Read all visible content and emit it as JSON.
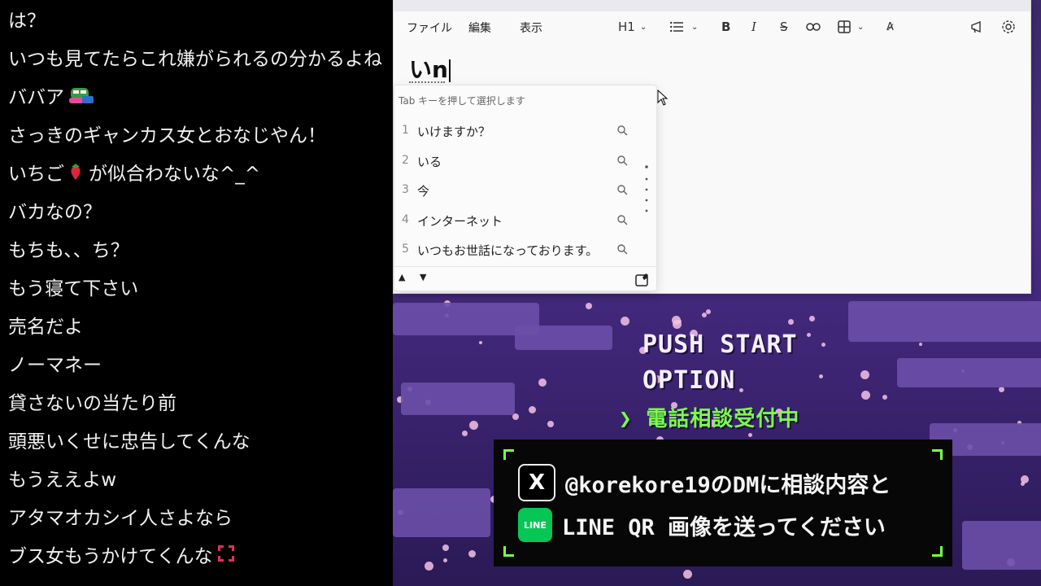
{
  "chat": {
    "messages": [
      {
        "text": "は？"
      },
      {
        "text": "いつも見てたらこれ嫌がられるの分かるよね"
      },
      {
        "text": "ババア",
        "emoji": "pixel-frog-emote"
      },
      {
        "text": "さっきのギャンカス女とおなじやん！"
      },
      {
        "text": "いちご",
        "emoji": "strawberry",
        "suffix": "が似合わないな^_^"
      },
      {
        "text": "バカなの？"
      },
      {
        "text": "もちも、、ち？"
      },
      {
        "text": "もう寝て下さい"
      },
      {
        "text": "売名だよ"
      },
      {
        "text": "ノーマネー"
      },
      {
        "text": "貸さないの当たり前"
      },
      {
        "text": "頭悪いくせに忠告してくんな"
      },
      {
        "text": "もうええよw"
      },
      {
        "text": "アタマオカシイ人さよなら"
      },
      {
        "text": "ブス女もうかけてくんな",
        "emoji": "anger-symbol"
      }
    ]
  },
  "editor": {
    "menu": {
      "file": "ファイル",
      "edit": "編集",
      "view": "表示"
    },
    "toolbar": {
      "heading": "H1",
      "icons": [
        "list-icon",
        "bold-icon",
        "italic-icon",
        "strikethrough-icon",
        "link-icon",
        "table-icon",
        "spellcheck-icon",
        "announce-icon",
        "settings-icon"
      ],
      "bold_label": "B",
      "italic_label": "I",
      "strike_label": "S"
    },
    "document_text": "いn"
  },
  "ime": {
    "hint": "Tab キーを押して選択します",
    "candidates": [
      {
        "num": "1",
        "text": "いけますか？"
      },
      {
        "num": "2",
        "text": "いる"
      },
      {
        "num": "3",
        "text": "今"
      },
      {
        "num": "4",
        "text": "インターネット"
      },
      {
        "num": "5",
        "text": "いつもお世話になっております。"
      }
    ]
  },
  "scene": {
    "push_start": "PUSH START",
    "option": "OPTION",
    "menu_selected": "電話相談受付中",
    "dm_line1": "@korekore19のDMに相談内容と",
    "dm_line2": "LINE QR 画像を送ってください",
    "line_icon_label": "LINE",
    "x_icon_label": "X",
    "accent_color": "#7bff4a"
  }
}
